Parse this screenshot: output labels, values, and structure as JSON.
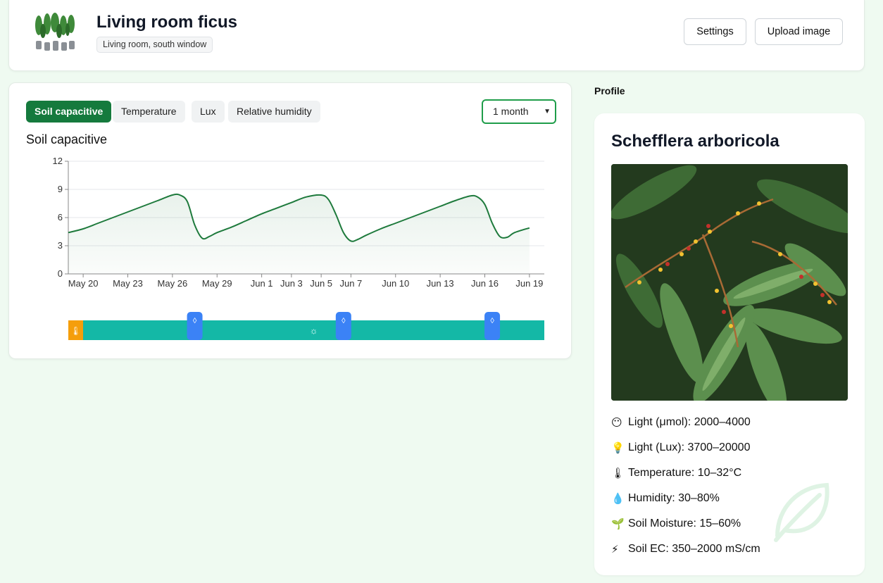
{
  "header": {
    "title": "Living room ficus",
    "location": "Living room, south window",
    "settings_label": "Settings",
    "upload_label": "Upload image"
  },
  "tabs": [
    {
      "label": "Soil capacitive",
      "active": true
    },
    {
      "label": "Temperature",
      "active": false
    },
    {
      "label": "Lux",
      "active": false
    },
    {
      "label": "Relative humidity",
      "active": false
    }
  ],
  "range_select": {
    "value": "1 month"
  },
  "colors": {
    "accent": "#157a3d",
    "line": "#1e7a3c",
    "timeline": "#14b8a6",
    "marker": "#3b82f6",
    "heat": "#f59e0b"
  },
  "chart_data": {
    "type": "area",
    "title": "Soil capacitive",
    "xlabel": "",
    "ylabel": "",
    "ylim": [
      0,
      12
    ],
    "yticks": [
      0,
      3,
      6,
      9,
      12
    ],
    "xtick_labels": [
      "May 20",
      "May 23",
      "May 26",
      "May 29",
      "Jun 1",
      "Jun 3",
      "Jun 5",
      "Jun 7",
      "Jun 10",
      "Jun 13",
      "Jun 16",
      "Jun 19"
    ],
    "xtick_days": [
      0,
      3,
      6,
      9,
      12,
      14,
      16,
      18,
      21,
      24,
      27,
      30
    ],
    "x_start_label": "May 20",
    "series": [
      {
        "name": "",
        "points": [
          [
            -1.0,
            4.4
          ],
          [
            0.0,
            4.8
          ],
          [
            1.0,
            5.4
          ],
          [
            2.0,
            6.0
          ],
          [
            3.0,
            6.6
          ],
          [
            4.0,
            7.2
          ],
          [
            5.0,
            7.8
          ],
          [
            6.0,
            8.4
          ],
          [
            6.5,
            8.4
          ],
          [
            7.0,
            7.7
          ],
          [
            7.5,
            5.2
          ],
          [
            8.0,
            3.8
          ],
          [
            8.5,
            4.0
          ],
          [
            9.0,
            4.4
          ],
          [
            10.0,
            5.0
          ],
          [
            11.0,
            5.7
          ],
          [
            12.0,
            6.4
          ],
          [
            13.0,
            7.0
          ],
          [
            14.0,
            7.6
          ],
          [
            15.0,
            8.2
          ],
          [
            16.0,
            8.4
          ],
          [
            16.5,
            7.9
          ],
          [
            17.0,
            6.3
          ],
          [
            17.5,
            4.4
          ],
          [
            18.0,
            3.5
          ],
          [
            18.5,
            3.7
          ],
          [
            19.0,
            4.1
          ],
          [
            20.0,
            4.8
          ],
          [
            21.0,
            5.4
          ],
          [
            22.0,
            6.0
          ],
          [
            23.0,
            6.6
          ],
          [
            24.0,
            7.2
          ],
          [
            25.0,
            7.8
          ],
          [
            26.0,
            8.3
          ],
          [
            26.5,
            8.2
          ],
          [
            27.0,
            7.4
          ],
          [
            27.5,
            5.4
          ],
          [
            28.0,
            4.0
          ],
          [
            28.5,
            3.9
          ],
          [
            29.0,
            4.4
          ],
          [
            30.0,
            4.9
          ]
        ]
      }
    ],
    "grid": true
  },
  "timeline": {
    "watering_days": [
      7.5,
      17.5,
      27.5
    ],
    "sun_day": 15.5,
    "heat_day": -1
  },
  "profile": {
    "section_label": "Profile",
    "species": "Schefflera arboricola",
    "care": [
      {
        "icon": "😶",
        "icon_name": "face-icon",
        "text": "Light (μmol): 2000–4000"
      },
      {
        "icon": "💡",
        "icon_name": "lightbulb-icon",
        "text": "Light (Lux): 3700–20000"
      },
      {
        "icon": "🌡",
        "icon_name": "thermometer-icon",
        "text": "Temperature: 10–32°C"
      },
      {
        "icon": "💧",
        "icon_name": "droplet-icon",
        "text": "Humidity: 30–80%"
      },
      {
        "icon": "🌱",
        "icon_name": "seedling-icon",
        "text": "Soil Moisture: 15–60%"
      },
      {
        "icon": "⚡",
        "icon_name": "lightning-icon",
        "text": "Soil EC: 350–2000 mS/cm"
      }
    ]
  }
}
